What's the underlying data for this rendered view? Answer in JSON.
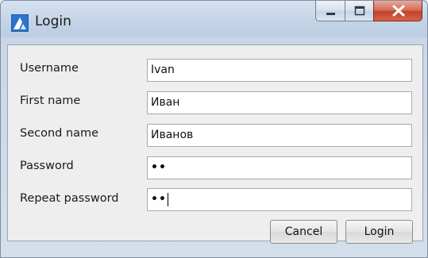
{
  "window": {
    "title": "Login",
    "controls": {
      "minimize": "minimize-icon",
      "maximize": "maximize-icon",
      "close": "close-icon"
    }
  },
  "form": {
    "fields": [
      {
        "label": "Username",
        "value": "Ivan"
      },
      {
        "label": "First name",
        "value": "Иван"
      },
      {
        "label": "Second name",
        "value": "Иванов"
      },
      {
        "label": "Password",
        "value": "••"
      },
      {
        "label": "Repeat password",
        "value": "••"
      }
    ]
  },
  "buttons": {
    "cancel": "Cancel",
    "login": "Login"
  },
  "colors": {
    "close_button": "#c3422b",
    "titlebar": "#c3d3e6",
    "panel": "#eeeeee"
  }
}
